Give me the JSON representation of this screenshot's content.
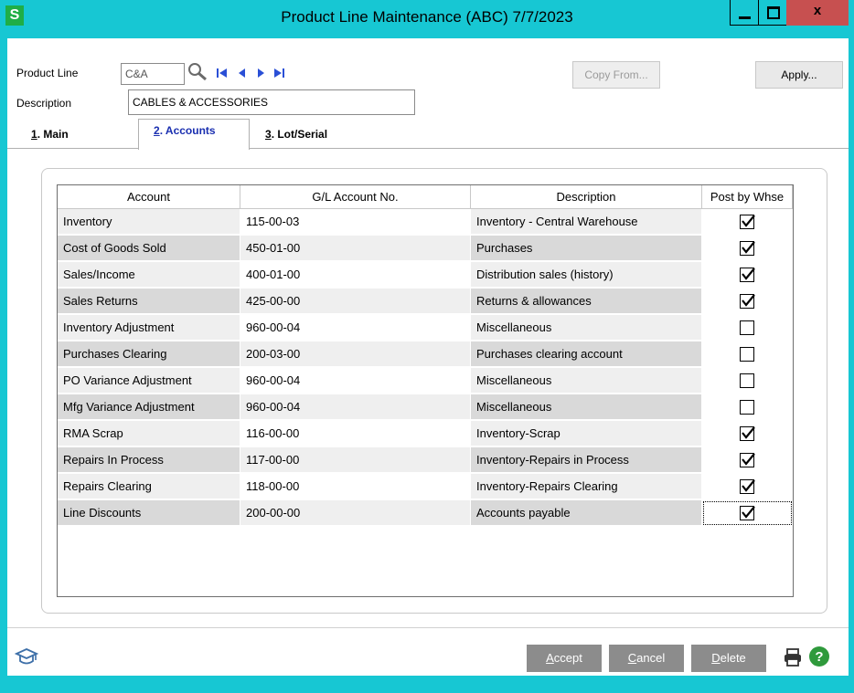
{
  "window": {
    "title": "Product Line Maintenance (ABC) 7/7/2023",
    "app_letter": "S",
    "close_glyph": "x"
  },
  "header": {
    "product_line_label": "Product Line",
    "product_line_value": "C&A",
    "description_label": "Description",
    "description_value": "CABLES & ACCESSORIES",
    "copy_from_label": "Copy From...",
    "apply_label": "Apply..."
  },
  "tabs": [
    {
      "key": "1",
      "label": ". Main"
    },
    {
      "key": "2",
      "label": ". Accounts"
    },
    {
      "key": "3",
      "label": ". Lot/Serial"
    }
  ],
  "grid": {
    "columns": [
      "Account",
      "G/L Account No.",
      "Description",
      "Post by Whse"
    ],
    "rows": [
      {
        "account": "Inventory",
        "gl": "115-00-03",
        "description": "Inventory - Central Warehouse",
        "post": true
      },
      {
        "account": "Cost of Goods Sold",
        "gl": "450-01-00",
        "description": "Purchases",
        "post": true
      },
      {
        "account": "Sales/Income",
        "gl": "400-01-00",
        "description": "Distribution sales (history)",
        "post": true
      },
      {
        "account": "Sales Returns",
        "gl": "425-00-00",
        "description": "Returns & allowances",
        "post": true
      },
      {
        "account": "Inventory Adjustment",
        "gl": "960-00-04",
        "description": "Miscellaneous",
        "post": false
      },
      {
        "account": "Purchases Clearing",
        "gl": "200-03-00",
        "description": "Purchases clearing account",
        "post": false
      },
      {
        "account": "PO Variance Adjustment",
        "gl": "960-00-04",
        "description": "Miscellaneous",
        "post": false
      },
      {
        "account": "Mfg Variance Adjustment",
        "gl": "960-00-04",
        "description": "Miscellaneous",
        "post": false
      },
      {
        "account": "RMA Scrap",
        "gl": "116-00-00",
        "description": "Inventory-Scrap",
        "post": true
      },
      {
        "account": "Repairs In Process",
        "gl": "117-00-00",
        "description": "Inventory-Repairs in Process",
        "post": true
      },
      {
        "account": "Repairs Clearing",
        "gl": "118-00-00",
        "description": "Inventory-Repairs Clearing",
        "post": true
      },
      {
        "account": "Line Discounts",
        "gl": "200-00-00",
        "description": "Accounts payable",
        "post": true
      }
    ]
  },
  "footer": {
    "accept_key": "A",
    "accept_rest": "ccept",
    "cancel_key": "C",
    "cancel_rest": "ancel",
    "delete_key": "D",
    "delete_rest": "elete"
  },
  "colors": {
    "titlebar": "#17c7d3",
    "close": "#c75050",
    "shaded_cell": "#d9d9d9",
    "light_cell": "#efefef",
    "action_button": "#8c8c8c"
  },
  "icons": [
    "search-icon",
    "first-record-icon",
    "previous-record-icon",
    "next-record-icon",
    "last-record-icon",
    "help-desk-icon",
    "printer-icon",
    "help-icon"
  ]
}
